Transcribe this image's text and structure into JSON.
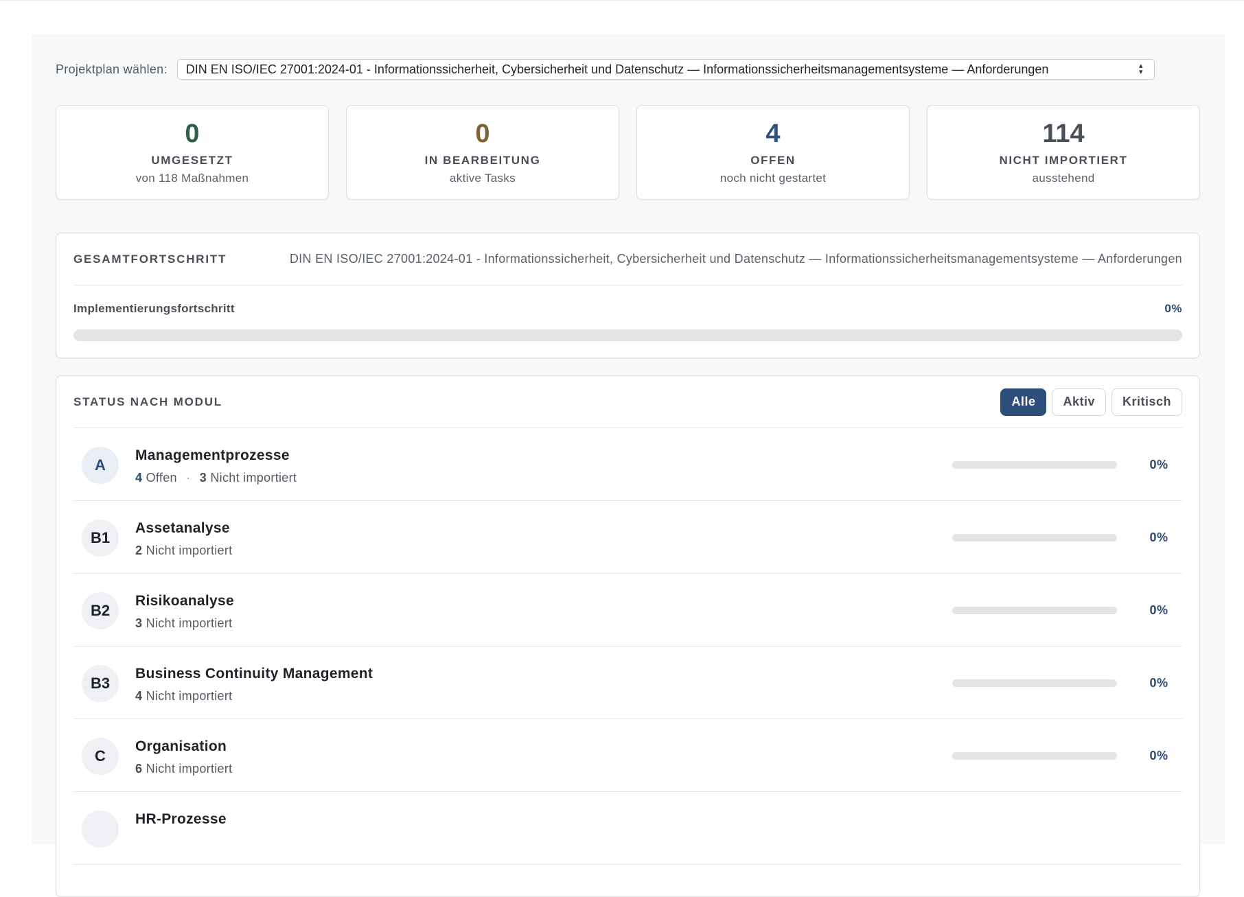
{
  "plan_selector": {
    "label": "Projektplan wählen:",
    "value": "DIN EN ISO/IEC 27001:2024-01 - Informationssicherheit, Cybersicherheit und Datenschutz — Informationssicherheitsmanagementsysteme — Anforderungen"
  },
  "kpis": [
    {
      "value": "0",
      "title": "UMGESETZT",
      "subtitle": "von 118 Maßnahmen",
      "color": "#2f5e49"
    },
    {
      "value": "0",
      "title": "IN BEARBEITUNG",
      "subtitle": "aktive Tasks",
      "color": "#7d6337"
    },
    {
      "value": "4",
      "title": "OFFEN",
      "subtitle": "noch nicht gestartet",
      "color": "#33507a"
    },
    {
      "value": "114",
      "title": "NICHT IMPORTIERT",
      "subtitle": "ausstehend",
      "color": "#4b5158"
    }
  ],
  "overall": {
    "title": "GESAMTFORTSCHRITT",
    "subtitle": "DIN EN ISO/IEC 27001:2024-01 - Informationssicherheit, Cybersicherheit und Datenschutz — Informationssicherheitsmanagementsysteme — Anforderungen",
    "progress_label": "Implementierungsfortschritt",
    "progress_text": "0%",
    "progress_fraction": 0
  },
  "status": {
    "title": "STATUS NACH MODUL",
    "filters": [
      {
        "label": "Alle",
        "active": true
      },
      {
        "label": "Aktiv",
        "active": false
      },
      {
        "label": "Kritisch",
        "active": false
      }
    ],
    "modules": [
      {
        "code": "A",
        "name": "Managementprozesse",
        "open_count": "4",
        "open_label": "Offen",
        "separator": "·",
        "notimported_count": "3",
        "notimported_label": "Nicht importiert",
        "percent": "0%",
        "progress_fraction": 0
      },
      {
        "code": "B1",
        "name": "Assetanalyse",
        "notimported_count": "2",
        "notimported_label": "Nicht importiert",
        "percent": "0%",
        "progress_fraction": 0
      },
      {
        "code": "B2",
        "name": "Risikoanalyse",
        "notimported_count": "3",
        "notimported_label": "Nicht importiert",
        "percent": "0%",
        "progress_fraction": 0
      },
      {
        "code": "B3",
        "name": "Business Continuity Management",
        "notimported_count": "4",
        "notimported_label": "Nicht importiert",
        "percent": "0%",
        "progress_fraction": 0
      },
      {
        "code": "C",
        "name": "Organisation",
        "notimported_count": "6",
        "notimported_label": "Nicht importiert",
        "percent": "0%",
        "progress_fraction": 0
      },
      {
        "code": "",
        "name": "HR-Prozesse",
        "notimported_count": "",
        "notimported_label": "",
        "percent": "",
        "progress_fraction": 0
      }
    ]
  }
}
